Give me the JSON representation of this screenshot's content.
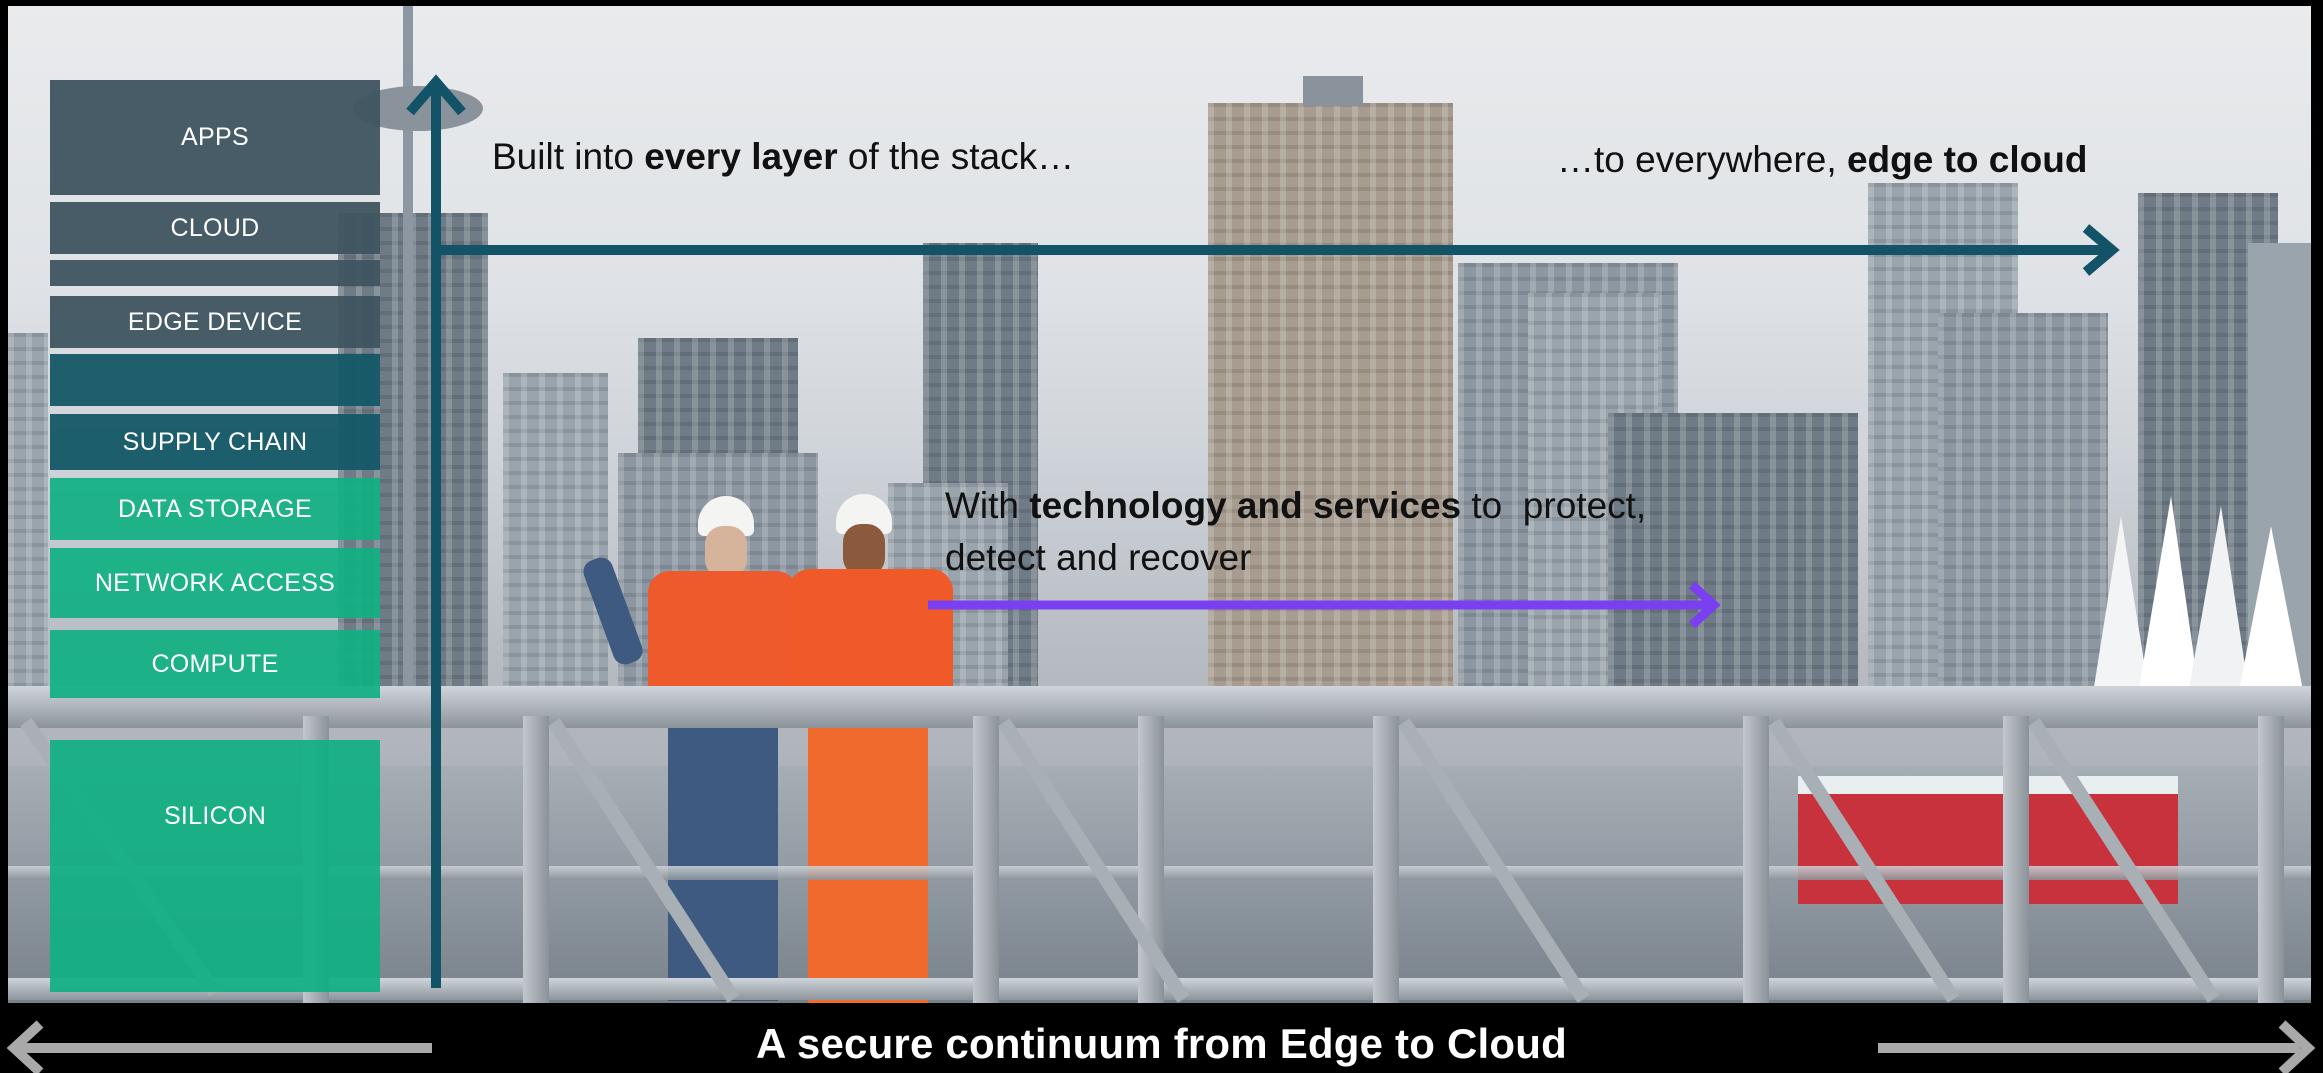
{
  "stack_layers": [
    {
      "label": "APPS",
      "style": "dark"
    },
    {
      "label": "CLOUD",
      "style": "dark"
    },
    {
      "label": "",
      "style": "dark"
    },
    {
      "label": "EDGE DEVICE",
      "style": "dark"
    },
    {
      "label": "",
      "style": "teal"
    },
    {
      "label": "SUPPLY CHAIN",
      "style": "teal"
    },
    {
      "label": "DATA STORAGE",
      "style": "green"
    },
    {
      "label": "NETWORK ACCESS",
      "style": "green"
    },
    {
      "label": "COMPUTE",
      "style": "green"
    },
    {
      "label": "SILICON",
      "style": "green"
    }
  ],
  "captions": {
    "layer_prefix": "Built into ",
    "layer_bold": "every layer",
    "layer_suffix": " of the stack…",
    "edge_prefix": "…to everywhere, ",
    "edge_bold": "edge to cloud",
    "tech_prefix": "With ",
    "tech_bold": "technology and services",
    "tech_suffix": " to  protect,",
    "tech_line2": "detect and recover"
  },
  "footer": {
    "title": "A secure continuum from Edge to Cloud"
  },
  "colors": {
    "arrow_dark": "#135368",
    "arrow_purple": "#7b3ff2",
    "footer_arrow": "#a9a9a9",
    "layer_dark": "#3e5460",
    "layer_teal": "#165868",
    "layer_green": "#10b082"
  }
}
